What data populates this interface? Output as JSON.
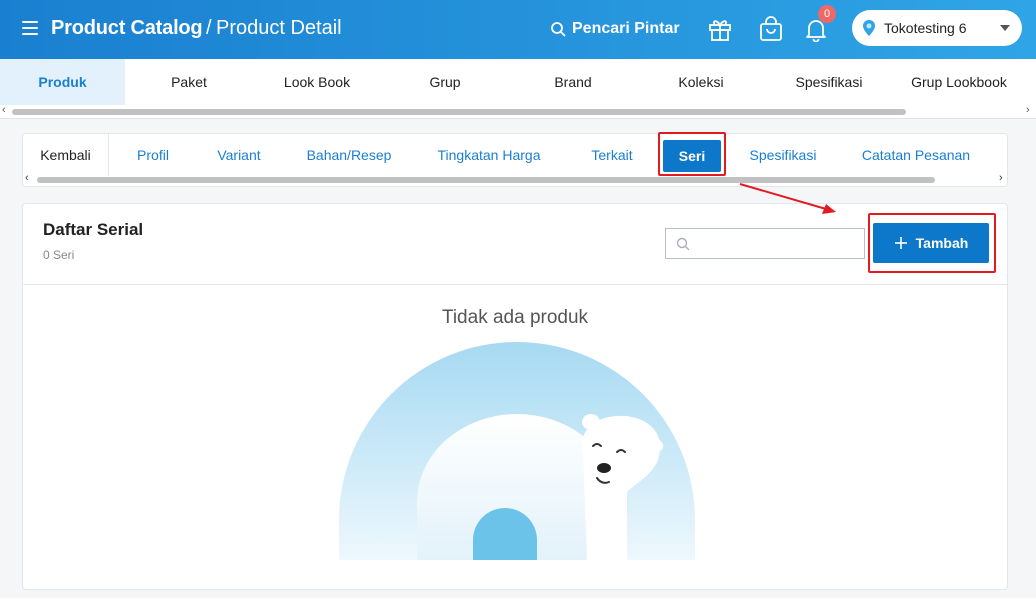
{
  "header": {
    "title": "Product Catalog",
    "separator": "/",
    "subtitle": "Product Detail",
    "smart_search": "Pencari Pintar",
    "notification_count": "0",
    "store_name": "Tokotesting 6",
    "icons": [
      "menu-icon",
      "search-icon",
      "gift-icon",
      "shopping-bag-icon",
      "bell-icon",
      "pin-icon",
      "chevron-down-icon"
    ]
  },
  "main_tabs": [
    "Produk",
    "Paket",
    "Look Book",
    "Grup",
    "Brand",
    "Koleksi",
    "Spesifikasi",
    "Grup Lookbook"
  ],
  "sub_tabs": {
    "back": "Kembali",
    "items": [
      "Profil",
      "Variant",
      "Bahan/Resep",
      "Tingkatan Harga",
      "Terkait",
      "Seri",
      "Spesifikasi",
      "Catatan Pesanan"
    ]
  },
  "card": {
    "title": "Daftar Serial",
    "count": "0 Seri",
    "search_placeholder": "",
    "add_label": "Tambah",
    "empty_message": "Tidak ada produk"
  },
  "colors": {
    "header_start": "#1a7fd0",
    "header_end": "#2fa5e6",
    "primary": "#0d78c9",
    "highlight": "#e21b23",
    "badge": "#f06767"
  }
}
